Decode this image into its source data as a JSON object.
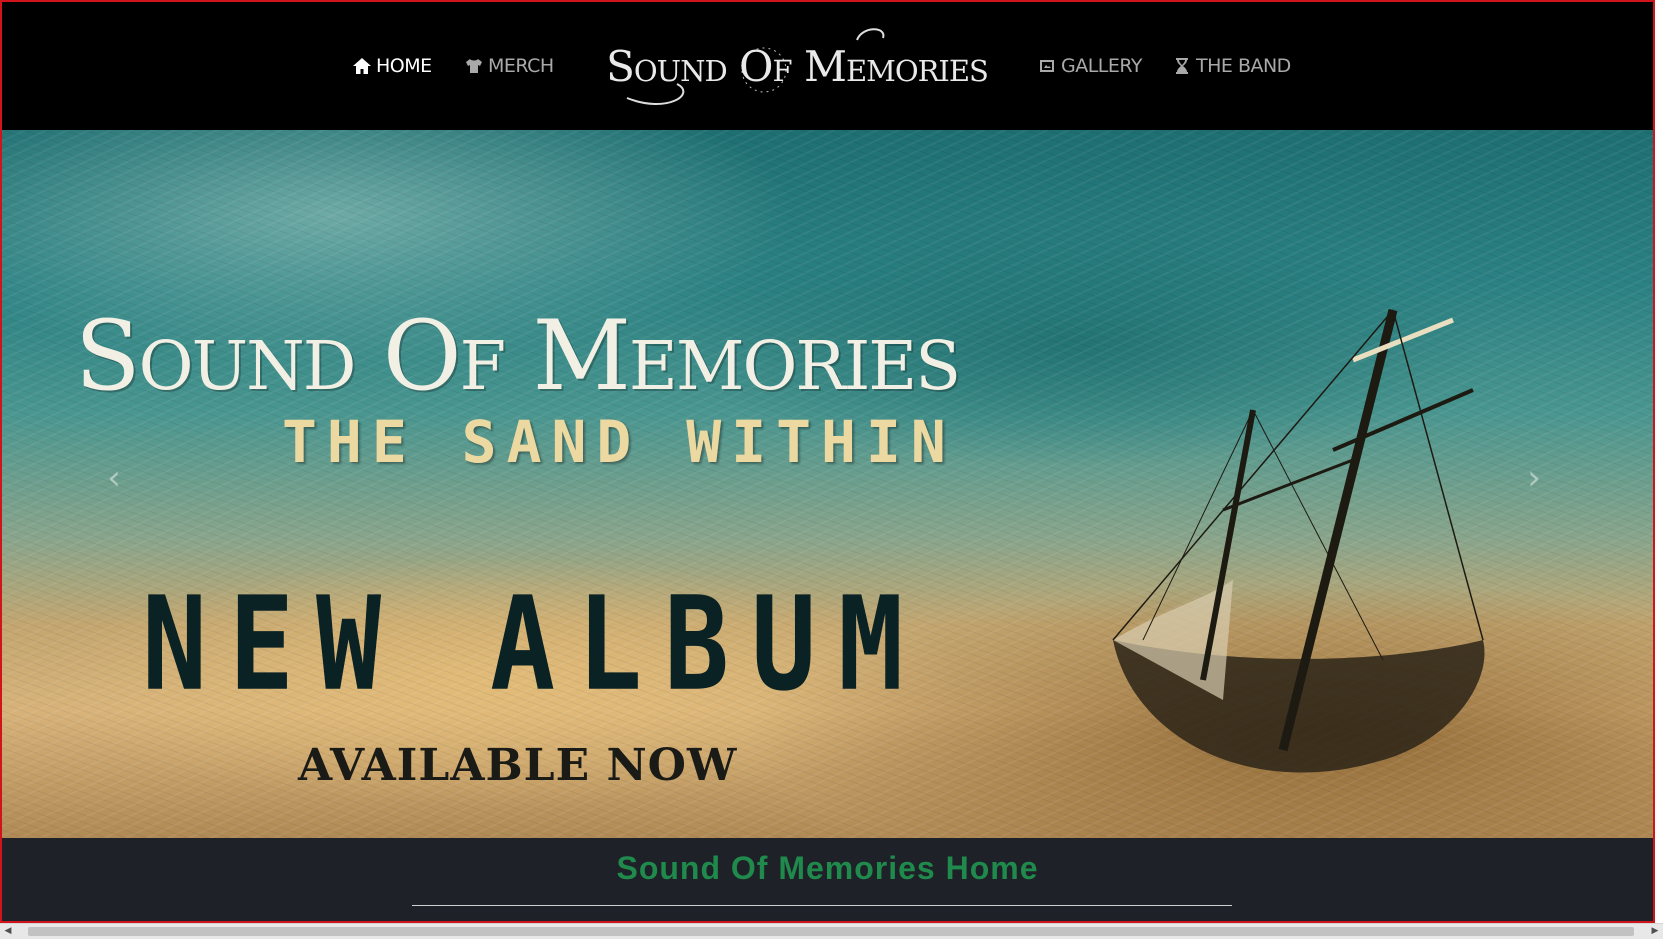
{
  "nav": {
    "items": [
      {
        "label": "HOME",
        "icon": "home-icon",
        "active": true
      },
      {
        "label": "MERCH",
        "icon": "tshirt-icon",
        "active": false
      },
      {
        "label": "GALLERY",
        "icon": "image-icon",
        "active": false
      },
      {
        "label": "THE BAND",
        "icon": "hourglass-icon",
        "active": false
      }
    ],
    "logo_text": "Sound Of Memories"
  },
  "hero": {
    "band_logo_text": "Sound Of Memories",
    "album_title": "THE SAND WITHIN",
    "headline": "NEW ALBUM",
    "subline": "AVAILABLE NOW",
    "prev_glyph": "‹",
    "next_glyph": "›"
  },
  "page": {
    "heading": "Sound Of Memories Home"
  },
  "scrollbar": {
    "left_glyph": "◀",
    "right_glyph": "▶"
  },
  "colors": {
    "nav_bg": "#000000",
    "nav_active": "#ffffff",
    "nav_inactive": "#a9a9a9",
    "heading": "#1f8a4c",
    "section_bg": "#1e2127",
    "frame_border": "#d0141b"
  }
}
